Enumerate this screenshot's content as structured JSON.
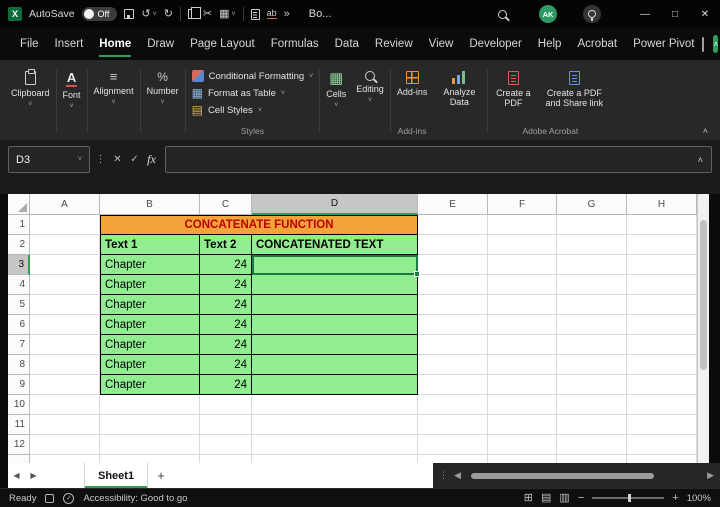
{
  "titlebar": {
    "autosave_label": "AutoSave",
    "autosave_state": "Off",
    "doc_title": "Bo...",
    "avatar": "AK"
  },
  "menubar": {
    "tabs": [
      "File",
      "Insert",
      "Home",
      "Draw",
      "Page Layout",
      "Formulas",
      "Data",
      "Review",
      "View",
      "Developer",
      "Help",
      "Acrobat",
      "Power Pivot"
    ],
    "active_tab": "Home"
  },
  "ribbon": {
    "collapsed_groups": [
      "Clipboard",
      "Font",
      "Alignment",
      "Number"
    ],
    "styles": {
      "items": [
        "Conditional Formatting",
        "Format as Table",
        "Cell Styles"
      ],
      "group_label": "Styles"
    },
    "cells_label": "Cells",
    "editing_label": "Editing",
    "addins_label": "Add-ins",
    "addins_group_label": "Add-ins",
    "analyze_label": "Analyze Data",
    "pdf_label": "Create a PDF",
    "pdf_share_label": "Create a PDF and Share link",
    "acrobat_group_label": "Adobe Acrobat"
  },
  "formula_bar": {
    "name_box": "D3",
    "fx_label": "fx",
    "value": ""
  },
  "sheet": {
    "columns": [
      "A",
      "B",
      "C",
      "D",
      "E",
      "F",
      "G",
      "H"
    ],
    "rows": [
      "1",
      "2",
      "3",
      "4",
      "5",
      "6",
      "7",
      "8",
      "9",
      "10",
      "11",
      "12"
    ],
    "selected_cell": "D3",
    "table": {
      "title": "CONCATENATE FUNCTION",
      "headers": [
        "Text 1",
        "Text 2",
        "CONCATENATED TEXT"
      ],
      "rows": [
        [
          "Chapter",
          "24",
          ""
        ],
        [
          "Chapter",
          "24",
          ""
        ],
        [
          "Chapter",
          "24",
          ""
        ],
        [
          "Chapter",
          "24",
          ""
        ],
        [
          "Chapter",
          "24",
          ""
        ],
        [
          "Chapter",
          "24",
          ""
        ],
        [
          "Chapter",
          "24",
          ""
        ]
      ]
    }
  },
  "tabbar": {
    "sheet_name": "Sheet1"
  },
  "statusbar": {
    "ready_label": "Ready",
    "accessibility_label": "Accessibility: Good to go",
    "zoom_value": "100%"
  },
  "colors": {
    "accent": "#2E9E5B",
    "title_fill": "#F2A43B",
    "title_text": "#C00000",
    "cell_fill": "#90EE90"
  },
  "icons": {
    "chevron_down": "˅",
    "chevron_up": "˄",
    "minimize": "—",
    "maximize": "□",
    "close": "✕",
    "undo": "↺",
    "redo": "↻",
    "cut": "✂",
    "overflow": "»",
    "dots_vertical": "⋮",
    "cancel": "✕",
    "enter": "✓",
    "left_arrow": "◀",
    "right_arrow": "▶",
    "plus": "+",
    "minus": "−",
    "grid_view": "⊞",
    "page_layout_view": "▤",
    "page_break_view": "▥",
    "align_lines": "≡",
    "percent": "%",
    "font_letter": "A",
    "table_grid": "▦",
    "styles_sheet": "▤",
    "spell_ab": "ab",
    "accessibility_check": "✓"
  }
}
